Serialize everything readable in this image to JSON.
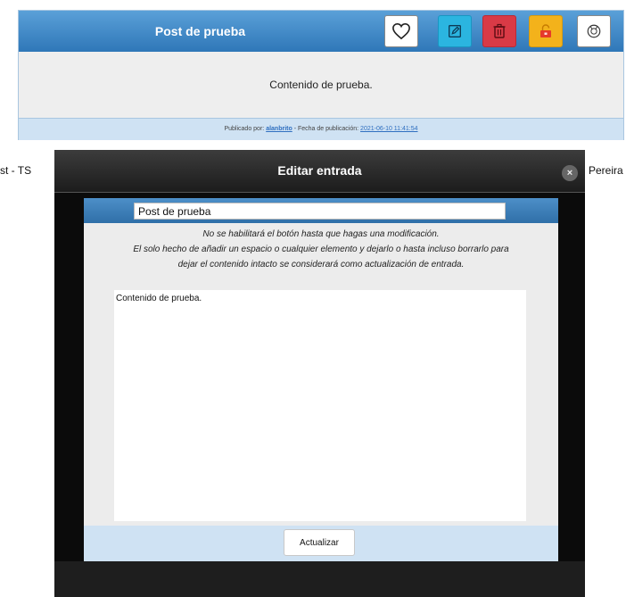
{
  "post": {
    "title": "Post de prueba",
    "content": "Contenido de prueba.",
    "footer": {
      "published_by_label": "Publicado por:",
      "author": "alanbrito",
      "date_label": "- Fecha de publicación:",
      "date": "2021-06-10 11:41:54"
    },
    "actions": [
      {
        "name": "like",
        "icon": "heart-icon",
        "color": "#ffffff"
      },
      {
        "name": "edit",
        "icon": "edit-icon",
        "color": "#2bb5e0"
      },
      {
        "name": "delete",
        "icon": "trash-icon",
        "color": "#d93a46"
      },
      {
        "name": "lock",
        "icon": "lock-icon",
        "color": "#f3b21b"
      },
      {
        "name": "more",
        "icon": "cycle-icon",
        "color": "#ffffff"
      }
    ]
  },
  "background": {
    "left_fragment": "st - TS",
    "right_fragment": "Pereira"
  },
  "modal": {
    "title": "Editar entrada",
    "close_icon": "×",
    "title_input_value": "Post de prueba",
    "notice_lines": [
      "No se habilitará el botón hasta que hagas una modificación.",
      "El solo hecho de añadir un espacio o cualquier elemento y dejarlo o hasta incluso borrarlo para",
      "dejar el contenido intacto se considerará como actualización de entrada."
    ],
    "content_value": "Contenido de prueba.",
    "update_label": "Actualizar"
  }
}
